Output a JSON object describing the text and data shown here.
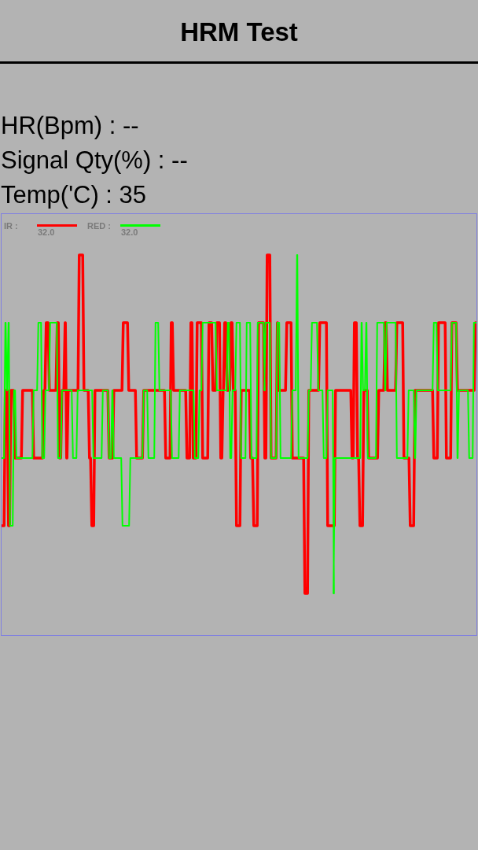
{
  "header": {
    "title": "HRM Test"
  },
  "readings": [
    {
      "text": "HR(Bpm) : --"
    },
    {
      "text": "Signal Qty(%) : --"
    },
    {
      "text": "Temp('C) : 35"
    }
  ],
  "chart": {
    "legend": [
      {
        "name": "IR :",
        "value": "32.0",
        "color": "#ff0000"
      },
      {
        "name": "RED :",
        "value": "32.0",
        "color": "#00ff00"
      }
    ]
  }
}
